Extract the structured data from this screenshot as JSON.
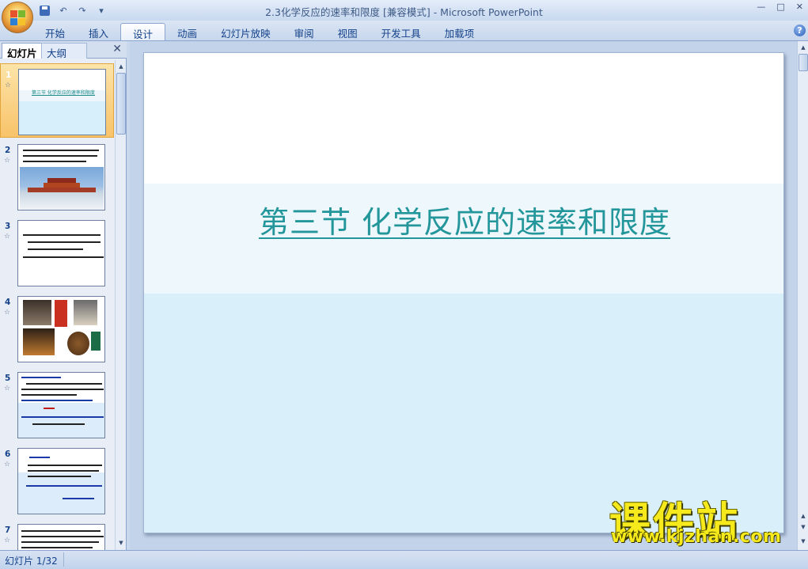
{
  "window": {
    "title": "2.3化学反应的速率和限度 [兼容模式] - Microsoft PowerPoint",
    "controls": [
      "—",
      "□",
      "✕"
    ]
  },
  "quick_access": {
    "undo_glyph": "↶",
    "redo_glyph": "↷",
    "customize_glyph": "▾"
  },
  "ribbon": {
    "tabs": [
      {
        "label": "开始"
      },
      {
        "label": "插入"
      },
      {
        "label": "设计",
        "active": true
      },
      {
        "label": "动画"
      },
      {
        "label": "幻灯片放映"
      },
      {
        "label": "审阅"
      },
      {
        "label": "视图"
      },
      {
        "label": "开发工具"
      },
      {
        "label": "加载项"
      }
    ],
    "help": "?"
  },
  "left_pane": {
    "tab_slides": "幻灯片",
    "tab_outline": "大纲",
    "close": "✕",
    "thumbnails": [
      {
        "number": "1",
        "star": "☆",
        "selected": true,
        "text": "第三节 化学反应的速率和限度"
      },
      {
        "number": "2",
        "star": "☆"
      },
      {
        "number": "3",
        "star": "☆"
      },
      {
        "number": "4",
        "star": "☆"
      },
      {
        "number": "5",
        "star": "☆"
      },
      {
        "number": "6",
        "star": "☆"
      },
      {
        "number": "7",
        "star": "☆"
      }
    ]
  },
  "slide": {
    "title": "第三节  化学反应的速率和限度"
  },
  "watermark": {
    "brand": "课件站",
    "url": "www.kjzhan.com"
  },
  "status": {
    "slide_counter": "幻灯片 1/32"
  },
  "colors": {
    "title_teal": "#22969a",
    "band": "#eef7fb",
    "lower": "#d9f0fb",
    "selection": "#f8c36a"
  }
}
